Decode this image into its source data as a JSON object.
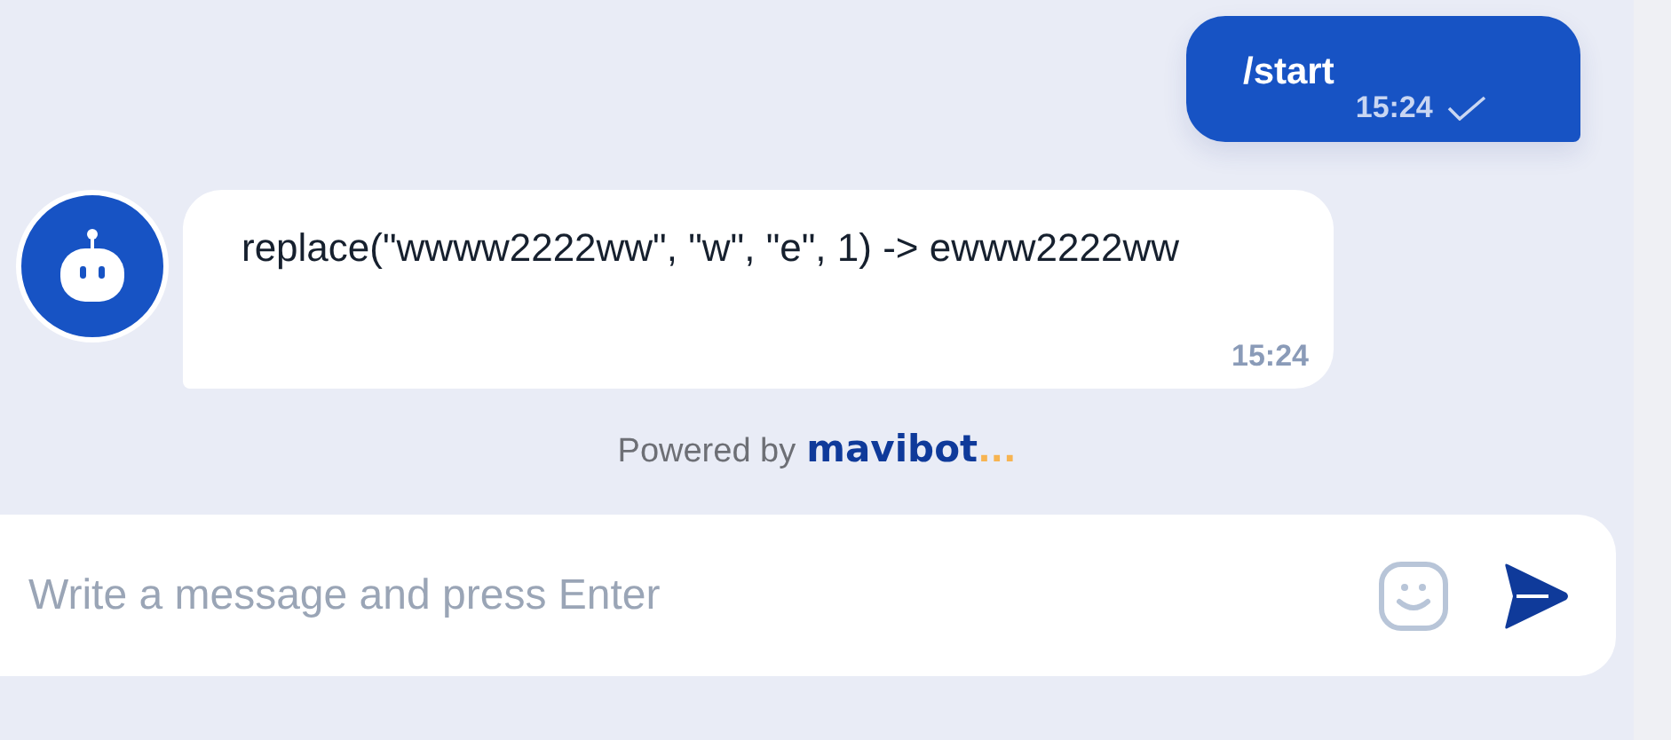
{
  "messages": [
    {
      "kind": "user",
      "text": "/start",
      "time": "15:24",
      "delivered": true
    },
    {
      "kind": "bot",
      "text": "replace(\"wwww2222ww\", \"w\", \"e\", 1) -> ewww2222ww",
      "time": "15:24"
    }
  ],
  "footer": {
    "prefix": "Powered by",
    "brand": "mavibot",
    "brand_suffix": "..."
  },
  "composer": {
    "placeholder": "Write a message and press Enter"
  }
}
